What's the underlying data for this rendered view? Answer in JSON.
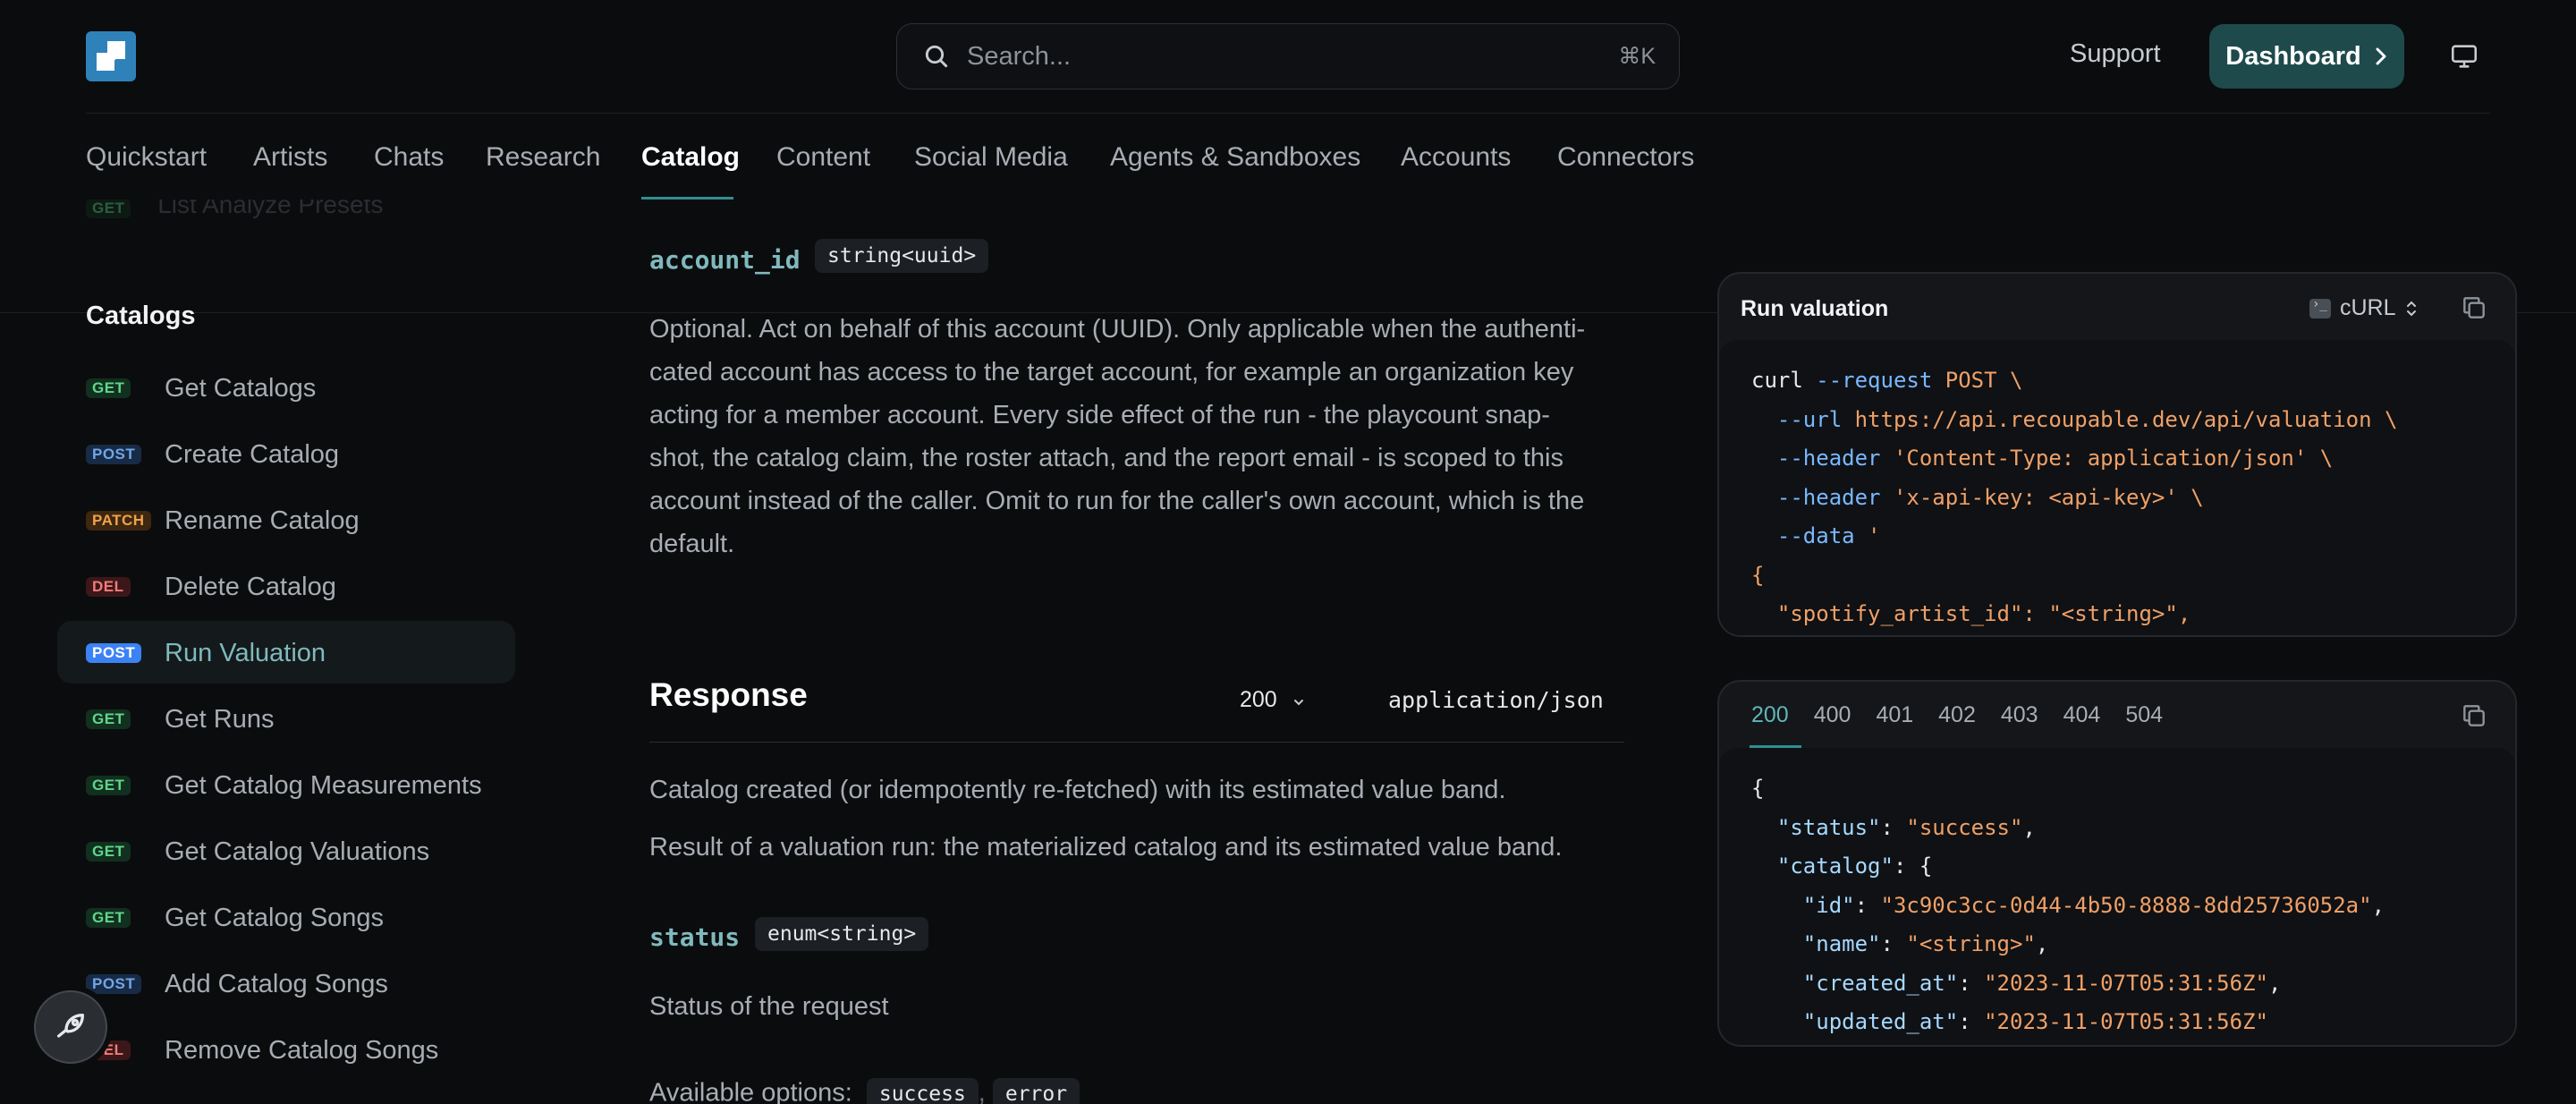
{
  "header": {
    "search_placeholder": "Search...",
    "search_shortcut": "⌘K",
    "support_label": "Support",
    "dashboard_label": "Dashboard"
  },
  "tabs": [
    {
      "label": "Quickstart"
    },
    {
      "label": "Artists"
    },
    {
      "label": "Chats"
    },
    {
      "label": "Research"
    },
    {
      "label": "Catalog"
    },
    {
      "label": "Content"
    },
    {
      "label": "Social Media"
    },
    {
      "label": "Agents & Sandboxes"
    },
    {
      "label": "Accounts"
    },
    {
      "label": "Connectors"
    }
  ],
  "active_tab": "Catalog",
  "sidebar": {
    "faded_item": {
      "method": "GET",
      "label": "List Analyze Presets"
    },
    "section_title": "Catalogs",
    "items": [
      {
        "method": "GET",
        "label": "Get Catalogs"
      },
      {
        "method": "POST",
        "label": "Create Catalog"
      },
      {
        "method": "PATCH",
        "label": "Rename Catalog"
      },
      {
        "method": "DEL",
        "label": "Delete Catalog"
      },
      {
        "method": "POST",
        "label": "Run Valuation",
        "active": true
      },
      {
        "method": "GET",
        "label": "Get Runs"
      },
      {
        "method": "GET",
        "label": "Get Catalog Measurements"
      },
      {
        "method": "GET",
        "label": "Get Catalog Valuations"
      },
      {
        "method": "GET",
        "label": "Get Catalog Songs"
      },
      {
        "method": "POST",
        "label": "Add Catalog Songs"
      },
      {
        "method": "DEL",
        "label": "Remove Catalog Songs"
      }
    ]
  },
  "main": {
    "param_name": "account_id",
    "param_type": "string<uuid>",
    "param_desc_lines": [
      "Optional. Act on behalf of this account (UUID). Only applicable when the authenti-",
      "cated account has access to the target account, for example an organization key",
      "acting for a member account. Every side effect of the run - the playcount snap-",
      "shot, the catalog claim, the roster attach, and the report email - is scoped to this",
      "account instead of the caller. Omit to run for the caller's own account, which is the",
      "default."
    ],
    "response_title": "Response",
    "response_code": "200",
    "response_content_type": "application/json",
    "response_desc_1": "Catalog created (or idempotently re-fetched) with its estimated value band.",
    "response_desc_2": "Result of a valuation run: the materialized catalog and its estimated value band.",
    "status_name": "status",
    "status_type": "enum<string>",
    "status_desc": "Status of the request",
    "available_label": "Available options:",
    "options": [
      "success",
      "error"
    ]
  },
  "request_panel": {
    "title": "Run valuation",
    "language": "cURL",
    "lines": [
      [
        {
          "t": "curl ",
          "c": "w"
        },
        {
          "t": "--request",
          "c": "b"
        },
        {
          "t": " POST \\",
          "c": "o"
        }
      ],
      [
        {
          "t": "  --url",
          "c": "b"
        },
        {
          "t": " https://api.recoupable.dev/api/valuation \\",
          "c": "o"
        }
      ],
      [
        {
          "t": "  --header",
          "c": "b"
        },
        {
          "t": " 'Content-Type: application/json' \\",
          "c": "o"
        }
      ],
      [
        {
          "t": "  --header",
          "c": "b"
        },
        {
          "t": " 'x-api-key: <api-key>' \\",
          "c": "o"
        }
      ],
      [
        {
          "t": "  --data",
          "c": "b"
        },
        {
          "t": " '",
          "c": "o"
        }
      ],
      [
        {
          "t": "{",
          "c": "o"
        }
      ],
      [
        {
          "t": "  \"spotify_artist_id\": \"<string>\",",
          "c": "o"
        }
      ]
    ]
  },
  "response_panel": {
    "codes": [
      "200",
      "400",
      "401",
      "402",
      "403",
      "404",
      "504"
    ],
    "active_code": "200",
    "lines": [
      [
        {
          "t": "{",
          "c": "w"
        }
      ],
      [
        {
          "t": "  \"status\"",
          "c": "k"
        },
        {
          "t": ": ",
          "c": "w"
        },
        {
          "t": "\"success\"",
          "c": "o"
        },
        {
          "t": ",",
          "c": "w"
        }
      ],
      [
        {
          "t": "  \"catalog\"",
          "c": "k"
        },
        {
          "t": ": {",
          "c": "w"
        }
      ],
      [
        {
          "t": "    \"id\"",
          "c": "k"
        },
        {
          "t": ": ",
          "c": "w"
        },
        {
          "t": "\"3c90c3cc-0d44-4b50-8888-8dd25736052a\"",
          "c": "o"
        },
        {
          "t": ",",
          "c": "w"
        }
      ],
      [
        {
          "t": "    \"name\"",
          "c": "k"
        },
        {
          "t": ": ",
          "c": "w"
        },
        {
          "t": "\"<string>\"",
          "c": "o"
        },
        {
          "t": ",",
          "c": "w"
        }
      ],
      [
        {
          "t": "    \"created_at\"",
          "c": "k"
        },
        {
          "t": ": ",
          "c": "w"
        },
        {
          "t": "\"2023-11-07T05:31:56Z\"",
          "c": "o"
        },
        {
          "t": ",",
          "c": "w"
        }
      ],
      [
        {
          "t": "    \"updated_at\"",
          "c": "k"
        },
        {
          "t": ": ",
          "c": "w"
        },
        {
          "t": "\"2023-11-07T05:31:56Z\"",
          "c": "o"
        }
      ]
    ]
  },
  "colors": {
    "accent": "#2e8f93",
    "background": "#0b0c0e",
    "dashboard_button": "#1e4a4c"
  }
}
